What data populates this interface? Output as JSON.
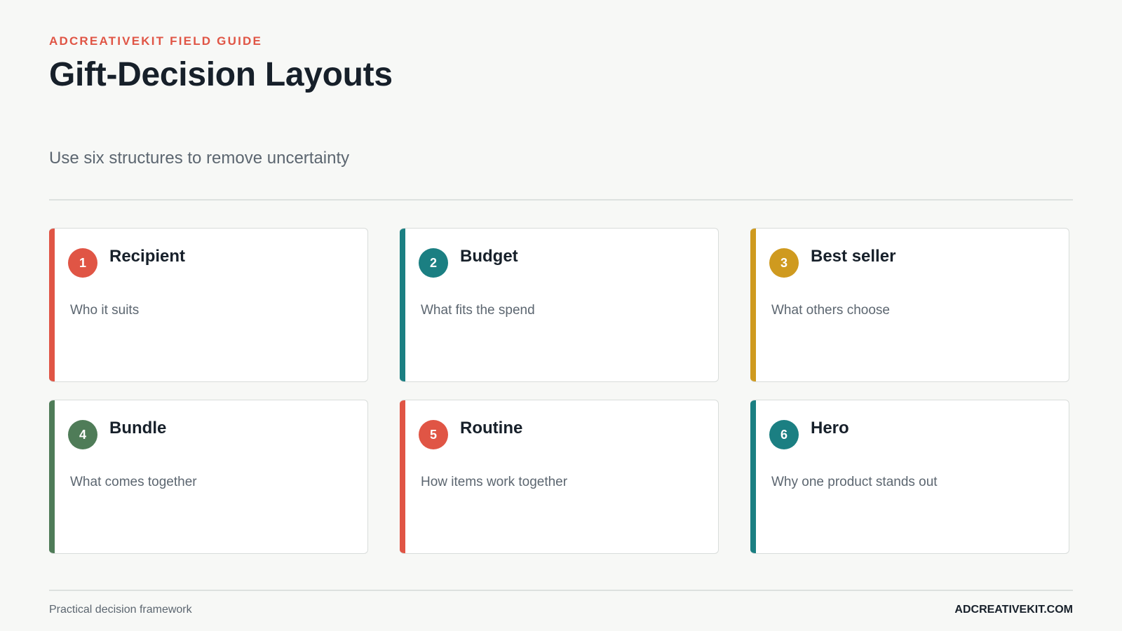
{
  "header": {
    "eyebrow": "ADCREATIVEKIT FIELD GUIDE",
    "title": "Gift-Decision Layouts",
    "subtitle": "Use six structures to remove uncertainty"
  },
  "colors": {
    "coral": "#e05545",
    "teal": "#1b7f82",
    "mustard": "#cf9a1f",
    "green": "#4f7c58"
  },
  "cards": [
    {
      "number": "1",
      "title": "Recipient",
      "description": "Who it suits",
      "accent": "#e05545"
    },
    {
      "number": "2",
      "title": "Budget",
      "description": "What fits the spend",
      "accent": "#1b7f82"
    },
    {
      "number": "3",
      "title": "Best seller",
      "description": "What others choose",
      "accent": "#cf9a1f"
    },
    {
      "number": "4",
      "title": "Bundle",
      "description": "What comes together",
      "accent": "#4f7c58"
    },
    {
      "number": "5",
      "title": "Routine",
      "description": "How items work together",
      "accent": "#e05545"
    },
    {
      "number": "6",
      "title": "Hero",
      "description": "Why one product stands out",
      "accent": "#1b7f82"
    }
  ],
  "footer": {
    "left": "Practical decision framework",
    "right": "ADCREATIVEKIT.COM"
  }
}
